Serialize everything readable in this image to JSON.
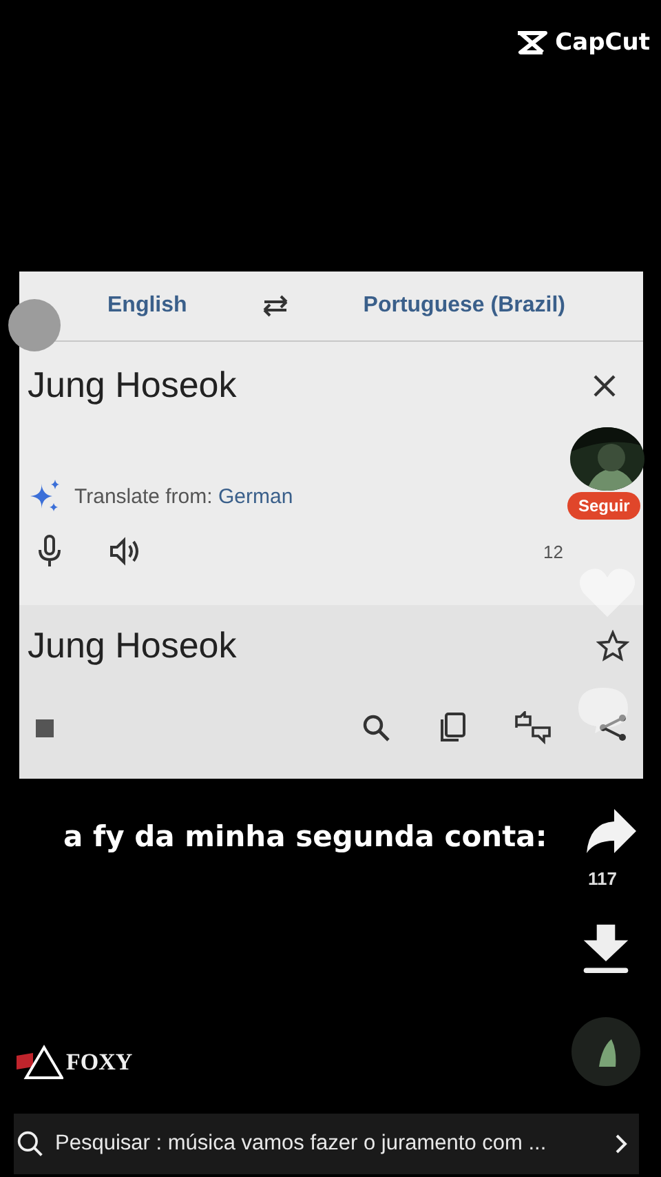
{
  "watermark_logo": {
    "text": "CapCut"
  },
  "translate": {
    "source_language": "English",
    "target_language": "Portuguese (Brazil)",
    "input_text": "Jung Hoseok",
    "detect_prefix": "Translate from: ",
    "detected_language": "German",
    "char_count": "12",
    "output_text": "Jung Hoseok"
  },
  "creator": {
    "follow_label": "Seguir"
  },
  "caption": "a fy da minha segunda conta:",
  "share_count": "117",
  "brand": "FOXY",
  "search_bar": {
    "label": "Pesquisar : música vamos fazer o juramento com ..."
  }
}
